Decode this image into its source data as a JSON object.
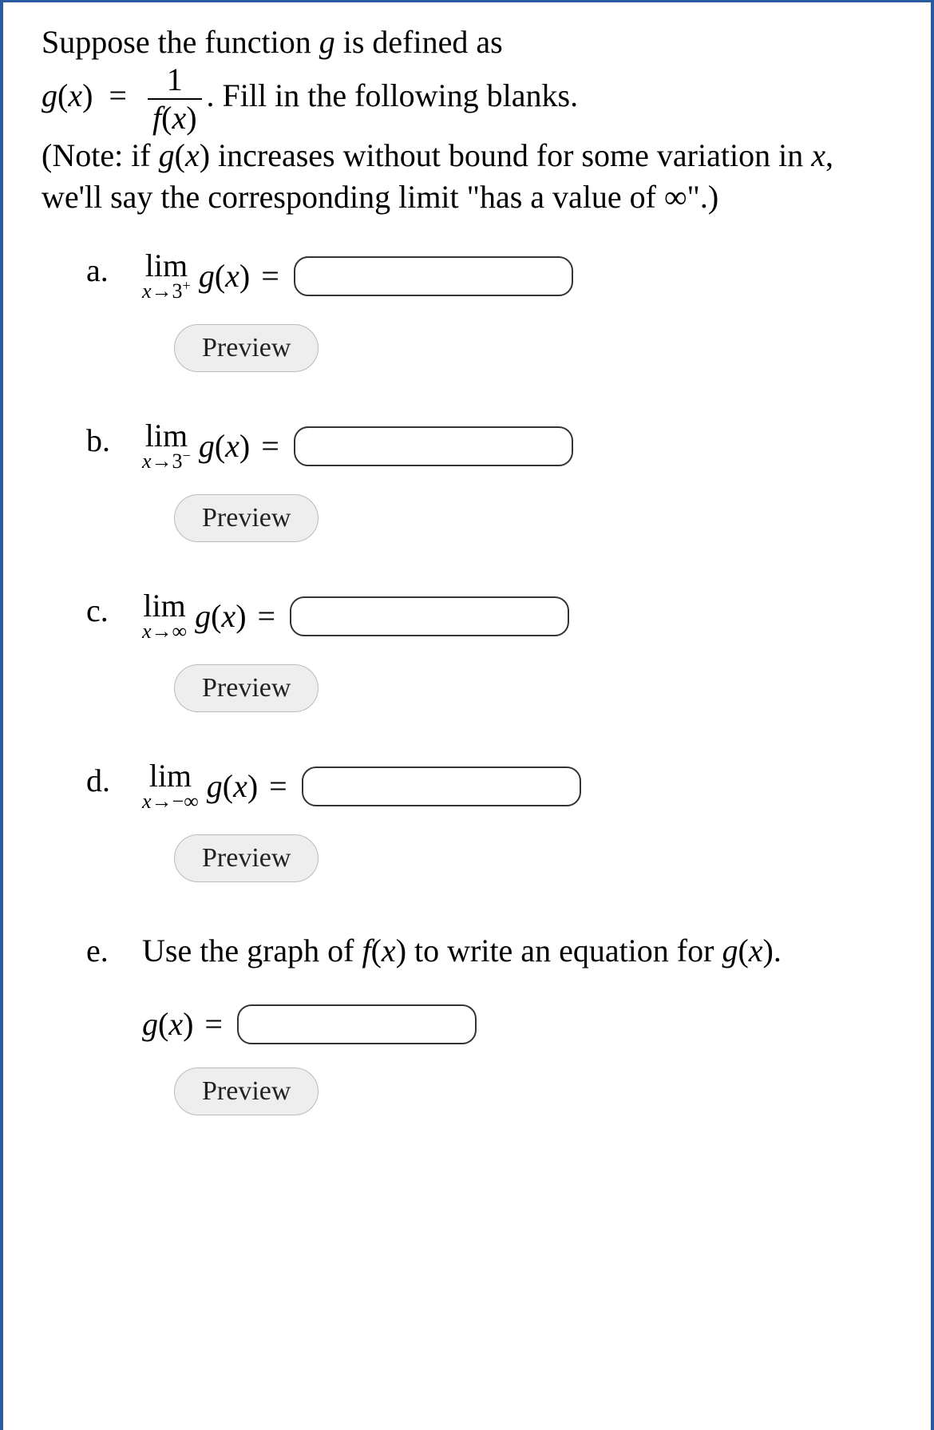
{
  "prompt": {
    "line1a": "Suppose the function ",
    "line1b": " is defined as",
    "g_of_x": "g(x)",
    "frac_numerator": "1",
    "frac_denominator": "f(x)",
    "fill_text": ". Fill in the following blanks.",
    "note": "(Note: if g(x) increases without bound for some variation in x, we'll say the corresponding limit \"has a value of ∞\".)"
  },
  "parts": {
    "a": {
      "marker": "a.",
      "lim_word": "lim",
      "lim_sub": "x→3",
      "lim_sup": "+",
      "func": "g(x)",
      "equals": "=",
      "preview": "Preview"
    },
    "b": {
      "marker": "b.",
      "lim_word": "lim",
      "lim_sub": "x→3",
      "lim_sup": "−",
      "func": "g(x)",
      "equals": "=",
      "preview": "Preview"
    },
    "c": {
      "marker": "c.",
      "lim_word": "lim",
      "lim_sub": "x→∞",
      "lim_sup": "",
      "func": "g(x)",
      "equals": "=",
      "preview": "Preview"
    },
    "d": {
      "marker": "d.",
      "lim_word": "lim",
      "lim_sub": "x→−∞",
      "lim_sup": "",
      "func": "g(x)",
      "equals": "=",
      "preview": "Preview"
    },
    "e": {
      "marker": "e.",
      "text": "Use the graph of f(x) to write an equation for g(x).",
      "gx": "g(x)",
      "equals": "=",
      "preview": "Preview"
    }
  }
}
